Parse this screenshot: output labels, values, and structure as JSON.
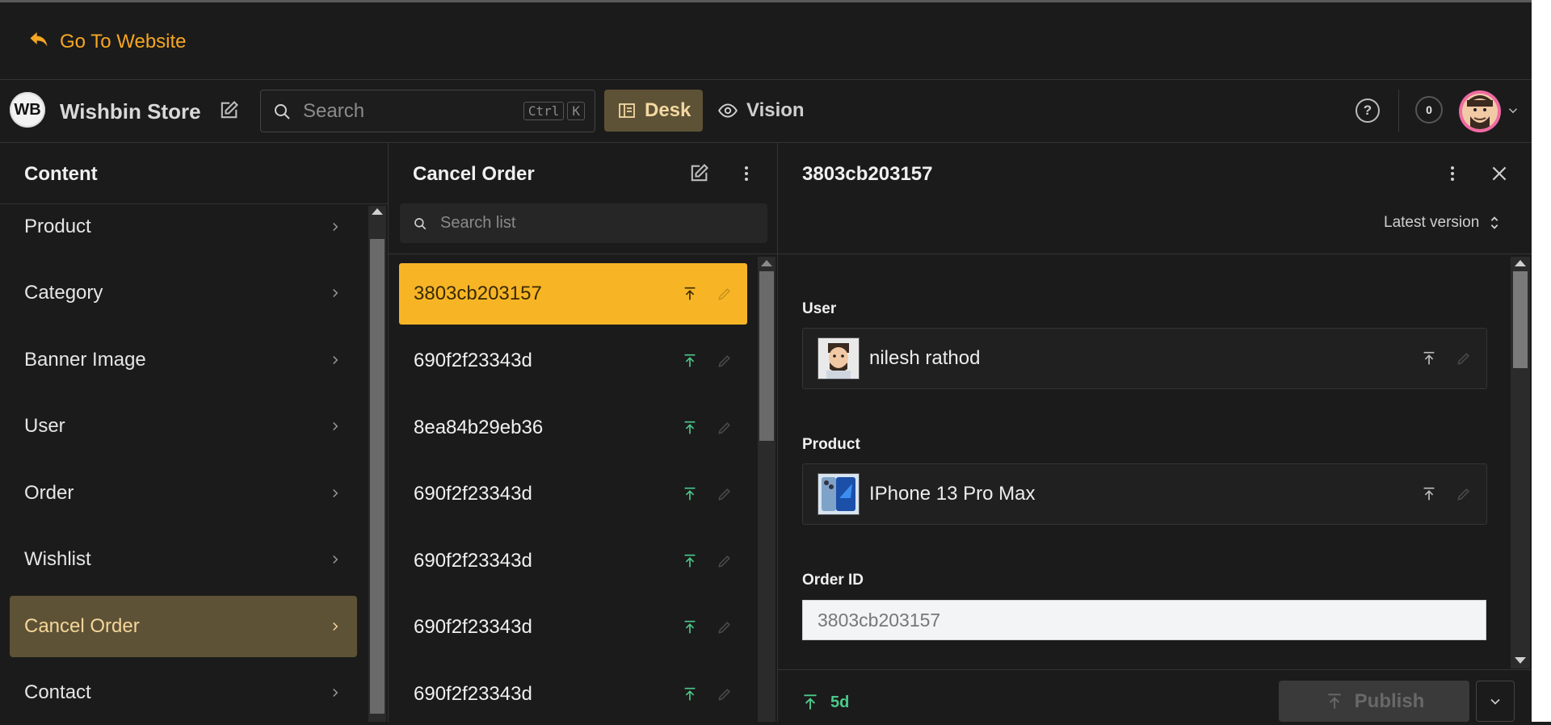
{
  "topbar": {
    "go_to_website": "Go To Website"
  },
  "header": {
    "logo_text": "WB",
    "store_name": "Wishbin Store",
    "search": {
      "placeholder": "Search",
      "shortcut_1": "Ctrl",
      "shortcut_2": "K"
    },
    "tabs": [
      {
        "label": "Desk",
        "active": true
      },
      {
        "label": "Vision",
        "active": false
      }
    ],
    "notification_count": "0"
  },
  "content_panel": {
    "title": "Content",
    "items": [
      {
        "label": "Product"
      },
      {
        "label": "Category"
      },
      {
        "label": "Banner Image"
      },
      {
        "label": "User"
      },
      {
        "label": "Order"
      },
      {
        "label": "Wishlist"
      },
      {
        "label": "Cancel Order",
        "active": true
      },
      {
        "label": "Contact"
      }
    ]
  },
  "list_panel": {
    "title": "Cancel Order",
    "search_placeholder": "Search list",
    "rows": [
      {
        "id": "3803cb203157",
        "selected": true
      },
      {
        "id": "690f2f23343d"
      },
      {
        "id": "8ea84b29eb36"
      },
      {
        "id": "690f2f23343d"
      },
      {
        "id": "690f2f23343d"
      },
      {
        "id": "690f2f23343d"
      },
      {
        "id": "690f2f23343d"
      }
    ]
  },
  "document": {
    "title": "3803cb203157",
    "version_label": "Latest version",
    "fields": {
      "user": {
        "label": "User",
        "value": "nilesh rathod"
      },
      "product": {
        "label": "Product",
        "value": "IPhone 13 Pro Max"
      },
      "order_id": {
        "label": "Order ID",
        "value": "3803cb203157"
      }
    },
    "status_time": "5d",
    "publish_label": "Publish"
  },
  "colors": {
    "accent": "#f5a623",
    "selected_row": "#f7b526",
    "active_nav": "#5e5236",
    "published_green": "#4cc98a"
  }
}
